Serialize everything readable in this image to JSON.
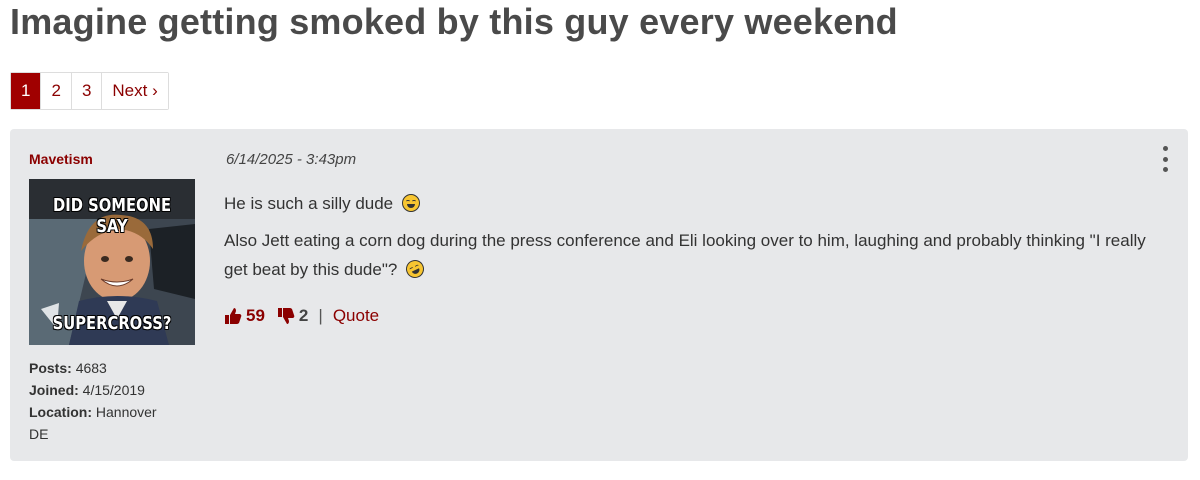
{
  "thread": {
    "title": "Imagine getting smoked by this guy every weekend"
  },
  "pagination": {
    "pages": [
      "1",
      "2",
      "3"
    ],
    "active": "1",
    "next_label": "Next ›"
  },
  "post": {
    "author": "Mavetism",
    "timestamp": "6/14/2025 - 3:43pm",
    "avatar": {
      "top_text": "DID SOMEONE SAY",
      "bottom_text": "SUPERCROSS?"
    },
    "stats": {
      "posts_label": "Posts:",
      "posts_value": "4683",
      "joined_label": "Joined:",
      "joined_value": "4/15/2019",
      "location_label": "Location:",
      "location_value": "Hannover DE"
    },
    "body": {
      "paragraph1": "He is such a silly dude",
      "paragraph2": "Also Jett eating a corn dog during the press conference and Eli looking over to him, laughing and probably thinking \"I really get beat by this dude\"?"
    },
    "reactions": {
      "upvotes": "59",
      "downvotes": "2",
      "separator": "|",
      "quote_label": "Quote"
    }
  },
  "colors": {
    "accent": "#8b0000",
    "active_page_bg": "#a00000",
    "card_bg": "#e7e8ea",
    "title": "#4a4a4a"
  },
  "icons": [
    "thumbs-up-icon",
    "thumbs-down-icon",
    "more-vertical-icon",
    "grinning-sweat-emoji",
    "rofl-emoji"
  ]
}
